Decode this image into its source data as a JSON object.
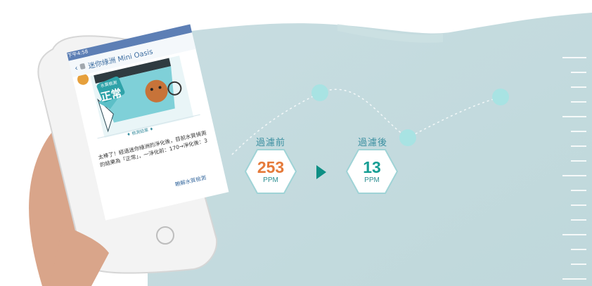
{
  "before": {
    "label": "過濾前",
    "value": "253",
    "unit": "PPM"
  },
  "after": {
    "label": "過濾後",
    "value": "13",
    "unit": "PPM"
  },
  "colors": {
    "teal_bg": "#c9dfe1",
    "orange": "#e57a3a",
    "teal": "#179e94",
    "hex_border": "#9fd3d6"
  },
  "phone": {
    "status_bar": "下午4:58",
    "app_title": "迷你綠洲 Mini Oasis",
    "badge_small": "水質檢測",
    "badge_big": "正常",
    "subtitle": "♦ 檢測結果 ♦",
    "message": "太棒了！經過迷你綠洲的淨化後，目前水質偵測的結果為「正常」，一淨化前：170→淨化後：3",
    "link": "瞭解水質檢測"
  }
}
